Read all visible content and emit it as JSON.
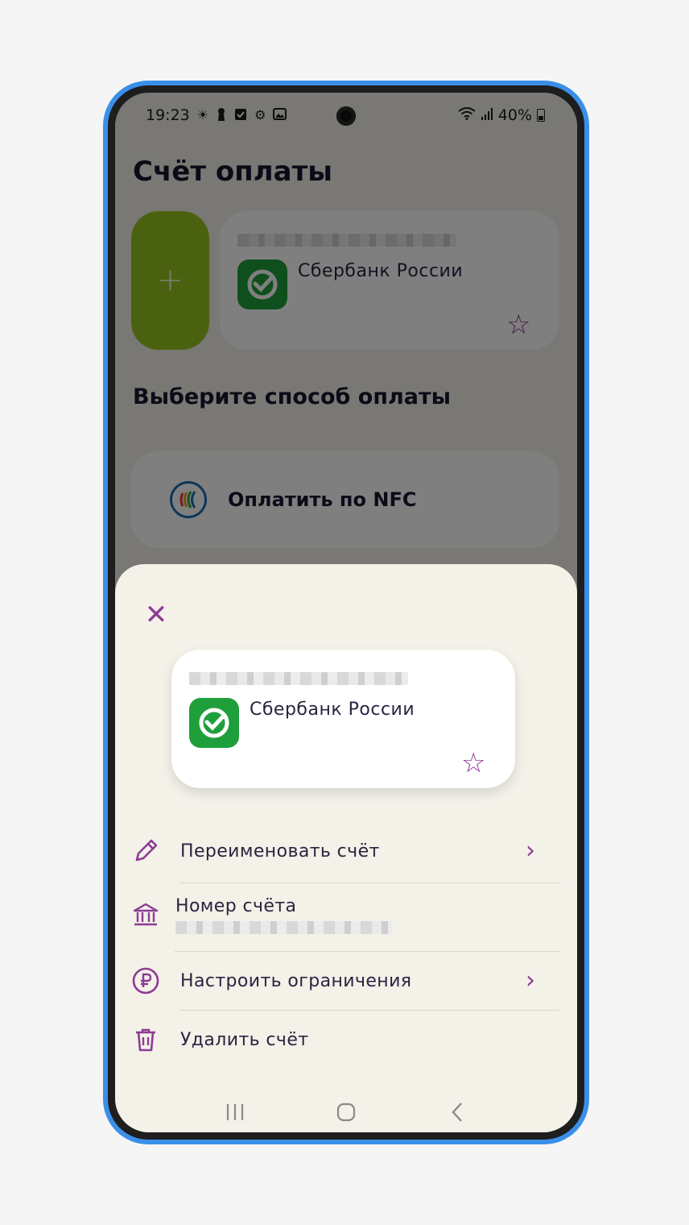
{
  "status_bar": {
    "time": "19:23",
    "battery": "40%",
    "icons": [
      "brightness-icon",
      "keyhole-icon",
      "checkbox-icon",
      "settings-icon",
      "image-icon",
      "wifi-icon",
      "signal-icon",
      "battery-icon"
    ]
  },
  "page": {
    "title": "Счёт оплаты",
    "account_card": {
      "bank_name": "Сбербанк России"
    },
    "payment_section_title": "Выберите способ оплаты",
    "nfc_label": "Оплатить по NFC"
  },
  "sheet": {
    "card": {
      "bank_name": "Сбербанк России"
    },
    "menu": {
      "rename": "Переименовать счёт",
      "account_number_label": "Номер счёта",
      "limits": "Настроить ограничения",
      "delete": "Удалить счёт"
    }
  },
  "colors": {
    "accent": "#8e3b94",
    "add_button": "#94c51e",
    "bank_green": "#1f9f3b",
    "device_frame": "#3a8fe8"
  }
}
